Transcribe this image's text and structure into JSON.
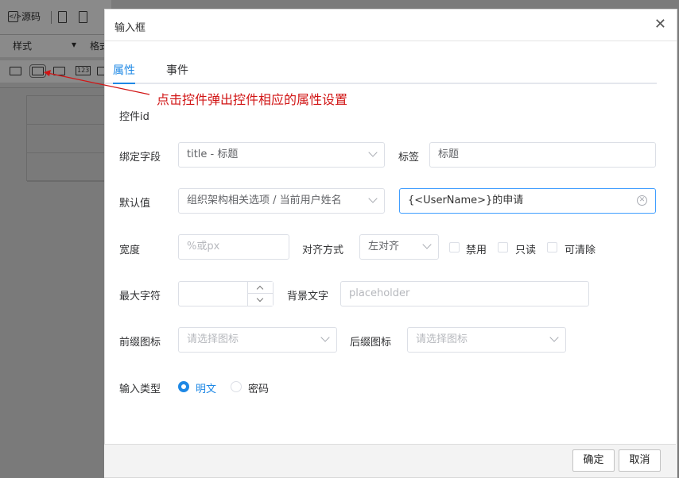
{
  "background_editor": {
    "source_button": "源码",
    "style_dropdown": "样式",
    "format_dropdown": "格式",
    "number_icon": "123"
  },
  "dialog": {
    "title": "输入框",
    "close_icon": "close-icon",
    "tabs": [
      {
        "label": "属性",
        "active": true
      },
      {
        "label": "事件",
        "active": false
      }
    ],
    "form": {
      "control_id_label": "控件id",
      "bind_field_label": "绑定字段",
      "bind_field_value": "title - 标题",
      "tag_label": "标签",
      "tag_value": "标题",
      "default_label": "默认值",
      "default_select_value": "组织架构相关选项 / 当前用户姓名",
      "default_input_value": "{<UserName>}的申请",
      "width_label": "宽度",
      "width_placeholder": "%或px",
      "align_label": "对齐方式",
      "align_value": "左对齐",
      "checkbox_disabled": "禁用",
      "checkbox_readonly": "只读",
      "checkbox_clearable": "可清除",
      "maxlen_label": "最大字符",
      "bgtext_label": "背景文字",
      "bgtext_placeholder": "placeholder",
      "prefix_icon_label": "前缀图标",
      "prefix_icon_placeholder": "请选择图标",
      "suffix_icon_label": "后缀图标",
      "suffix_icon_placeholder": "请选择图标",
      "input_type_label": "输入类型",
      "input_type_plain": "明文",
      "input_type_password": "密码",
      "input_type_selected": "明文"
    },
    "footer": {
      "confirm": "确定",
      "cancel": "取消"
    }
  },
  "annotation": {
    "text": "点击控件弹出控件相应的属性设置",
    "color": "#d11515"
  },
  "colors": {
    "accent": "#1e88e5",
    "annotation": "#d11515"
  }
}
